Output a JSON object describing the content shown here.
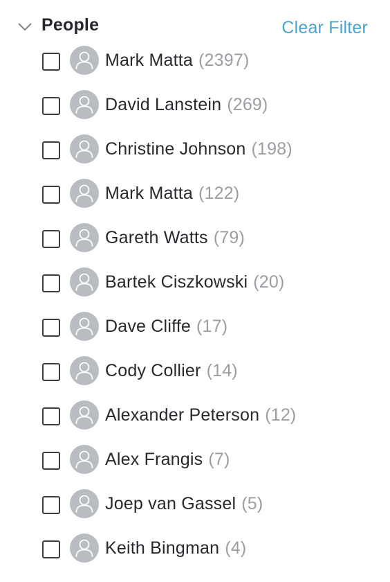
{
  "filter": {
    "title": "People",
    "clear_label": "Clear Filter"
  },
  "icons": {
    "toggle": "chevron-down-icon",
    "checkbox": "checkbox-icon",
    "avatar": "person-icon"
  },
  "colors": {
    "accent": "#4aa3c9",
    "avatar_bg": "#b9bcc0",
    "count_text": "#9a9ea3"
  },
  "people": [
    {
      "name": "Mark Matta",
      "count": "(2397)"
    },
    {
      "name": "David Lanstein",
      "count": "(269)"
    },
    {
      "name": "Christine Johnson",
      "count": "(198)"
    },
    {
      "name": "Mark Matta",
      "count": "(122)"
    },
    {
      "name": "Gareth Watts",
      "count": "(79)"
    },
    {
      "name": "Bartek Ciszkowski",
      "count": "(20)"
    },
    {
      "name": "Dave Cliffe",
      "count": "(17)"
    },
    {
      "name": "Cody Collier",
      "count": "(14)"
    },
    {
      "name": "Alexander Peterson",
      "count": "(12)"
    },
    {
      "name": "Alex Frangis",
      "count": "(7)"
    },
    {
      "name": "Joep van Gassel",
      "count": "(5)"
    },
    {
      "name": "Keith Bingman",
      "count": "(4)"
    }
  ]
}
